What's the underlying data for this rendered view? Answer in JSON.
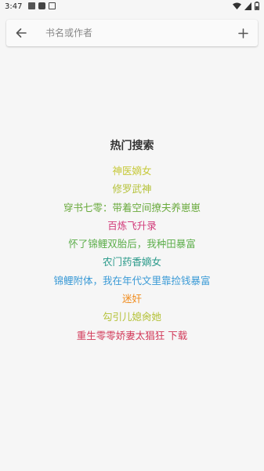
{
  "status_bar": {
    "time": "3:47",
    "left_icons": [
      "image-icon",
      "square-icon",
      "a-box-icon"
    ],
    "right_icons": [
      "wifi-icon",
      "signal-icon",
      "battery-icon"
    ]
  },
  "search": {
    "placeholder": "书名或作者",
    "value": "",
    "back_icon": "arrow-left-icon",
    "add_icon": "plus-icon"
  },
  "hot": {
    "title": "热门搜索",
    "items": [
      {
        "label": "神医嫡女",
        "color": "#c7c93a"
      },
      {
        "label": "修罗武神",
        "color": "#b5c23a"
      },
      {
        "label": "穿书七零：带着空间撩夫养崽崽",
        "color": "#6aaa3d"
      },
      {
        "label": "百炼飞升录",
        "color": "#d23a7a"
      },
      {
        "label": "怀了锦鲤双胎后，我种田暴富",
        "color": "#5cae4a"
      },
      {
        "label": "农门药香嫡女",
        "color": "#2a9a8a"
      },
      {
        "label": "锦鲤附体，我在年代文里靠捡钱暴富",
        "color": "#3a9ad6"
      },
      {
        "label": "迷奸",
        "color": "#f08c1e"
      },
      {
        "label": "勾引儿媳肏她",
        "color": "#b5c23a"
      },
      {
        "label": "重生零零娇妻太猖狂 下载",
        "color": "#d23a5a"
      }
    ]
  }
}
